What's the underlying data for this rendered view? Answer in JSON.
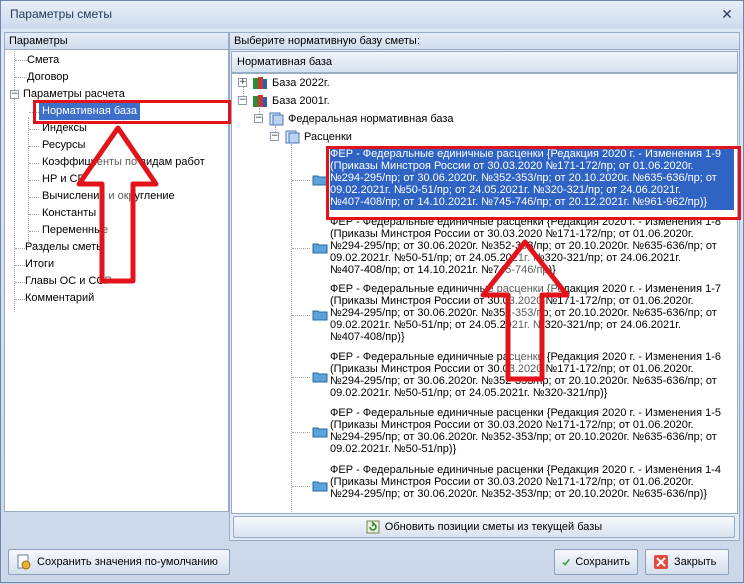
{
  "window": {
    "title": "Параметры сметы",
    "close_glyph": "✕"
  },
  "left": {
    "header": "Параметры",
    "items": [
      {
        "label": "Смета"
      },
      {
        "label": "Договор"
      },
      {
        "label": "Параметры расчета"
      },
      {
        "label": "Нормативная база"
      },
      {
        "label": "Индексы"
      },
      {
        "label": "Ресурсы"
      },
      {
        "label": "Коэффициенты по видам работ"
      },
      {
        "label": "НР и СП"
      },
      {
        "label": "Вычисления и округление"
      },
      {
        "label": "Константы"
      },
      {
        "label": "Переменные"
      },
      {
        "label": "Разделы сметы"
      },
      {
        "label": "Итоги"
      },
      {
        "label": "Главы ОС и ССР"
      },
      {
        "label": "Комментарий"
      }
    ],
    "expander_glyph": "−"
  },
  "right": {
    "header": "Выберите нормативную базу сметы:",
    "column_header": "Нормативная база",
    "base2022": "База 2022г.",
    "base2001": "База 2001г.",
    "federal": "Федеральная нормативная база",
    "rates": "Расценки",
    "plus_glyph": "+",
    "minus_glyph": "−",
    "entries": [
      {
        "lines": [
          "ФЕР - Федеральные единичные расценки {Редакция 2020 г. - Изменения 1-9",
          "(Приказы Минстроя России от 30.03.2020 №171-172/пр; от 01.06.2020г.",
          "№294-295/пр; от 30.06.2020г. №352-353/пр; от 20.10.2020г. №635-636/пр; от",
          "09.02.2021г. №50-51/пр; от 24.05.2021г. №320-321/пр; от 24.06.2021г.",
          "№407-408/пр; от 14.10.2021г. №745-746/пр; от 20.12.2021г. №961-962/пр)}"
        ]
      },
      {
        "lines": [
          "ФЕР - Федеральные единичные расценки {Редакция 2020 г. - Изменения 1-8",
          "(Приказы Минстроя России от 30.03.2020 №171-172/пр; от 01.06.2020г.",
          "№294-295/пр; от 30.06.2020г. №352-353/пр; от 20.10.2020г. №635-636/пр; от",
          "09.02.2021г. №50-51/пр; от 24.05.2021г. №320-321/пр; от 24.06.2021г.",
          "№407-408/пр; от 14.10.2021г. №745-746/пр)}"
        ]
      },
      {
        "lines": [
          "ФЕР - Федеральные единичные расценки {Редакция 2020 г. - Изменения 1-7",
          "(Приказы Минстроя России от 30.03.2020 №171-172/пр; от 01.06.2020г.",
          "№294-295/пр; от 30.06.2020г. №352-353/пр; от 20.10.2020г. №635-636/пр; от",
          "09.02.2021г. №50-51/пр; от 24.05.2021г. №320-321/пр; от 24.06.2021г.",
          "№407-408/пр)}"
        ]
      },
      {
        "lines": [
          "ФЕР - Федеральные единичные расценки {Редакция 2020 г. - Изменения 1-6",
          "(Приказы Минстроя России от 30.03.2020 №171-172/пр; от 01.06.2020г.",
          "№294-295/пр; от 30.06.2020г. №352-353/пр; от 20.10.2020г. №635-636/пр; от",
          "09.02.2021г. №50-51/пр; от 24.05.2021г. №320-321/пр)}"
        ]
      },
      {
        "lines": [
          "ФЕР - Федеральные единичные расценки {Редакция 2020 г. - Изменения 1-5",
          "(Приказы Минстроя России от 30.03.2020 №171-172/пр; от 01.06.2020г.",
          "№294-295/пр; от 30.06.2020г. №352-353/пр; от 20.10.2020г. №635-636/пр; от",
          "09.02.2021г. №50-51/пр)}"
        ]
      },
      {
        "lines": [
          "ФЕР - Федеральные единичные расценки {Редакция 2020 г. - Изменения 1-4",
          "(Приказы Минстроя России от 30.03.2020 №171-172/пр; от 01.06.2020г.",
          "№294-295/пр; от 30.06.2020г. №352-353/пр; от 20.10.2020г. №635-636/пр)}"
        ]
      }
    ],
    "update_button": "Обновить позиции сметы из текущей базы"
  },
  "footer": {
    "save_defaults": "Сохранить значения по-умолчанию",
    "save": "Сохранить",
    "close": "Закрыть"
  },
  "colors": {
    "selection": "#2f63c4",
    "annotation": "#e3131b"
  }
}
